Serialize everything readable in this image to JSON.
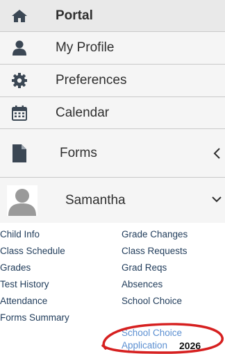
{
  "nav": {
    "items": [
      {
        "label": "Portal",
        "icon": "home-icon"
      },
      {
        "label": "My Profile",
        "icon": "user-icon"
      },
      {
        "label": "Preferences",
        "icon": "gear-icon"
      },
      {
        "label": "Calendar",
        "icon": "calendar-icon"
      },
      {
        "label": "Forms",
        "icon": "file-icon"
      },
      {
        "label": "Samantha",
        "icon": "avatar-icon"
      }
    ]
  },
  "student_links": {
    "left": [
      "Child Info",
      "Class Schedule",
      "Grades",
      "Test History",
      "Attendance",
      "Forms Summary"
    ],
    "right": [
      "Grade Changes",
      "Class Requests",
      "Grad Reqs",
      "Absences",
      "School Choice"
    ],
    "school_choice_app_line1": "School Choice",
    "school_choice_app_line2": "Application",
    "school_choice_app_year": "2026"
  },
  "colors": {
    "nav_bg": "#f5f5f5",
    "icon": "#3b4754",
    "link": "#1f3b5a",
    "link_highlight": "#5b8fd1",
    "annotation_ring": "#d62020"
  }
}
